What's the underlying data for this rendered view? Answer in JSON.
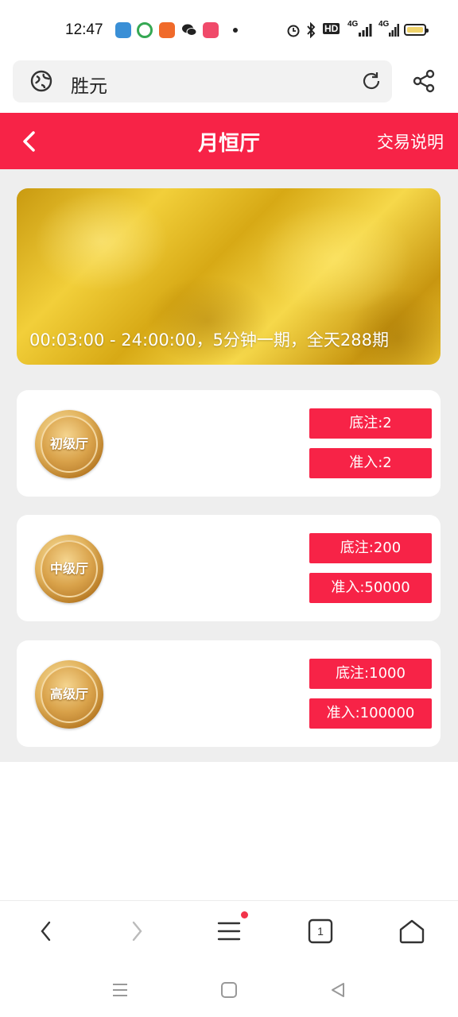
{
  "status_bar": {
    "time": "12:47",
    "network_1": "4G",
    "network_2": "4G",
    "hd_label": "HD",
    "app_icons": [
      {
        "name": "app-icon-1",
        "color": "#3a8fd6"
      },
      {
        "name": "app-icon-2",
        "color": "#35a853"
      },
      {
        "name": "app-icon-3",
        "color": "#f06a2a"
      },
      {
        "name": "wechat-icon",
        "color": "#222222"
      },
      {
        "name": "app-icon-5",
        "color": "#f04a6a"
      }
    ]
  },
  "browser": {
    "url_text": "胜元"
  },
  "header": {
    "title": "月恒厅",
    "help_label": "交易说明"
  },
  "banner": {
    "schedule_text": "00:03:00 - 24:00:00，5分钟一期，全天288期"
  },
  "rooms": [
    {
      "name": "初级厅",
      "base_bet": "底注:2",
      "entry": "准入:2"
    },
    {
      "name": "中级厅",
      "base_bet": "底注:200",
      "entry": "准入:50000"
    },
    {
      "name": "高级厅",
      "base_bet": "底注:1000",
      "entry": "准入:100000"
    }
  ],
  "bottom_bar": {
    "tab_count": "1"
  },
  "colors": {
    "accent": "#f72347",
    "content_bg": "#eeeeee"
  }
}
